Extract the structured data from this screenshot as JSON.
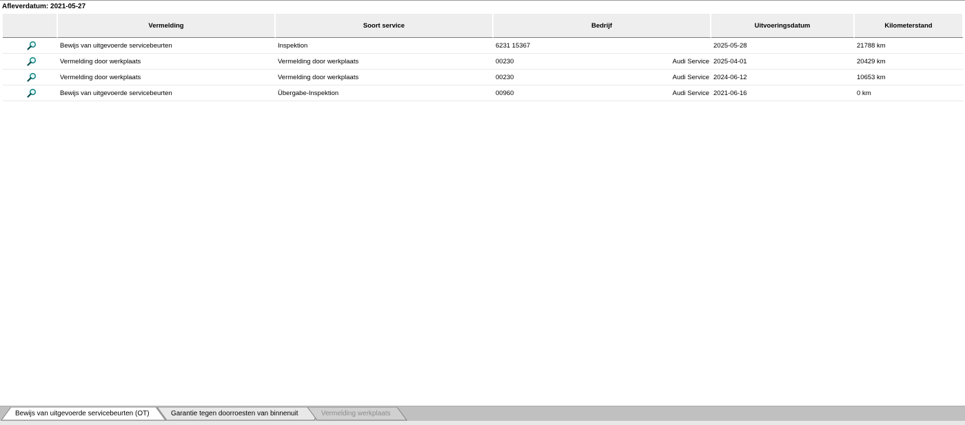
{
  "header": {
    "delivery_date": "Afleverdatum: 2021-05-27"
  },
  "table": {
    "columns": [
      "",
      "Vermelding",
      "Soort service",
      "Bedrijf",
      "Uitvoeringsdatum",
      "Kilometerstand"
    ],
    "rows": [
      {
        "entry": "Bewijs van uitgevoerde servicebeurten",
        "service": "Inspektion",
        "company_code": "6231 15367",
        "company_name": "",
        "date": "2025-05-28",
        "mileage": "21788 km"
      },
      {
        "entry": "Vermelding door werkplaats",
        "service": "Vermelding door werkplaats",
        "company_code": "00230",
        "company_name": "Audi Service",
        "date": "2025-04-01",
        "mileage": "20429 km"
      },
      {
        "entry": "Vermelding door werkplaats",
        "service": "Vermelding door werkplaats",
        "company_code": "00230",
        "company_name": "Audi Service",
        "date": "2024-06-12",
        "mileage": "10653 km"
      },
      {
        "entry": "Bewijs van uitgevoerde servicebeurten",
        "service": "Übergabe-Inspektion",
        "company_code": "00960",
        "company_name": "Audi Service",
        "date": "2021-06-16",
        "mileage": "0 km"
      }
    ],
    "row_icon": "magnifier-icon"
  },
  "tabs": [
    {
      "label": "Bewijs van uitgevoerde servicebeurten (OT)",
      "state": "active"
    },
    {
      "label": "Garantie tegen doorroesten van binnenuit",
      "state": "normal"
    },
    {
      "label": "Vermelding werkplaats",
      "state": "disabled"
    }
  ],
  "colors": {
    "header_bg": "#eeeeee",
    "tabbar_bg": "#c0c0c0",
    "icon_teal": "#1a8a8a"
  }
}
